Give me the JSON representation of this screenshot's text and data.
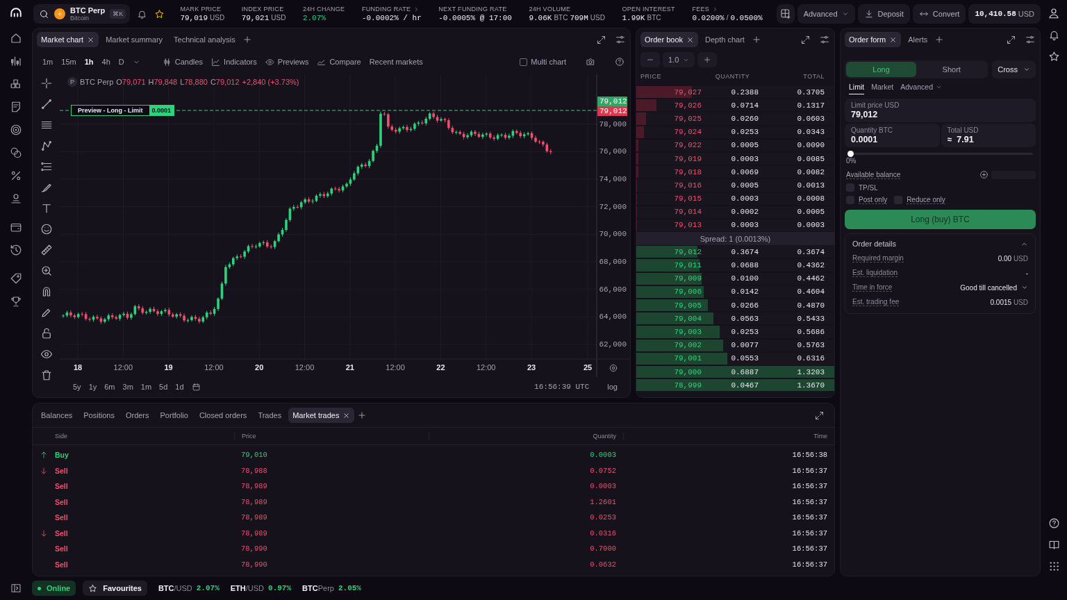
{
  "topbar": {
    "market": {
      "symbol": "BTC Perp",
      "name": "Bitcoin",
      "shortcut": "⌘K"
    },
    "favourite": true,
    "stats": [
      {
        "label": "MARK PRICE",
        "link": false,
        "parts": [
          {
            "text": "79,019",
            "kind": "num"
          },
          {
            "text": "USD",
            "kind": "unit"
          }
        ]
      },
      {
        "label": "INDEX PRICE",
        "link": false,
        "parts": [
          {
            "text": "79,021",
            "kind": "num"
          },
          {
            "text": "USD",
            "kind": "unit"
          }
        ]
      },
      {
        "label": "24H CHANGE",
        "link": false,
        "parts": [
          {
            "text": "2.07%",
            "kind": "up"
          }
        ]
      },
      {
        "label": "FUNDING RATE",
        "link": true,
        "parts": [
          {
            "text": "-0.0002% / hr",
            "kind": "num"
          }
        ]
      },
      {
        "label": "NEXT FUNDING RATE",
        "link": false,
        "parts": [
          {
            "text": "-0.0005% @ 17:00",
            "kind": "num"
          }
        ]
      },
      {
        "label": "24H VOLUME",
        "link": false,
        "parts": [
          {
            "text": "9.06K",
            "kind": "num"
          },
          {
            "text": "BTC",
            "kind": "unit"
          },
          {
            "text": "709M",
            "kind": "num"
          },
          {
            "text": "USD",
            "kind": "unit"
          }
        ]
      },
      {
        "label": "OPEN INTEREST",
        "link": false,
        "parts": [
          {
            "text": "1.99K",
            "kind": "num"
          },
          {
            "text": "BTC",
            "kind": "unit"
          }
        ]
      },
      {
        "label": "FEES",
        "link": true,
        "parts": [
          {
            "text": "0.0200%",
            "kind": "num"
          },
          {
            "text": "/",
            "kind": "unit"
          },
          {
            "text": "0.0500%",
            "kind": "num"
          }
        ]
      }
    ],
    "mode": "Advanced",
    "deposit": "Deposit",
    "convert": "Convert",
    "balance": {
      "value": "10,410.58",
      "unit": "USD"
    }
  },
  "chart_panel": {
    "tabs": [
      {
        "label": "Market chart",
        "selected": true
      },
      {
        "label": "Market summary",
        "selected": false
      },
      {
        "label": "Technical analysis",
        "selected": false
      }
    ],
    "timeframes": [
      {
        "label": "1m",
        "selected": false
      },
      {
        "label": "15m",
        "selected": false
      },
      {
        "label": "1h",
        "selected": true
      },
      {
        "label": "4h",
        "selected": false
      },
      {
        "label": "D",
        "selected": false
      }
    ],
    "tools": [
      {
        "label": "Candles",
        "kind": "candles"
      },
      {
        "label": "Indicators",
        "kind": "indicators"
      },
      {
        "label": "Previews",
        "kind": "previews"
      },
      {
        "label": "Compare",
        "kind": "compare"
      },
      {
        "label": "Recent markets",
        "kind": "plain"
      }
    ],
    "multi_chart": {
      "label": "Multi chart",
      "checked": false
    },
    "legend": {
      "symbol": "BTC Perp",
      "badge": "P",
      "values": [
        {
          "key": "O",
          "value": "79,071"
        },
        {
          "key": "H",
          "value": "79,848"
        },
        {
          "key": "L",
          "value": "78,880"
        },
        {
          "key": "C",
          "value": "79,012"
        }
      ],
      "change": "+2,840 (+3.73%)"
    },
    "preview": {
      "text": "Preview - Long - Limit",
      "quantity": "0.0001"
    },
    "price_axis": [
      "78,000",
      "76,000",
      "74,000",
      "72,000",
      "70,000",
      "68,000",
      "66,000",
      "64,000",
      "62,000"
    ],
    "price_tags": [
      {
        "text": "79,012",
        "kind": "last"
      },
      {
        "text": "79,012",
        "kind": "order"
      }
    ],
    "time_axis": [
      {
        "text": "18",
        "kind": "day"
      },
      {
        "text": "12:00",
        "kind": "time"
      },
      {
        "text": "19",
        "kind": "day"
      },
      {
        "text": "12:00",
        "kind": "time"
      },
      {
        "text": "20",
        "kind": "day"
      },
      {
        "text": "12:00",
        "kind": "time"
      },
      {
        "text": "21",
        "kind": "day"
      },
      {
        "text": "12:00",
        "kind": "time"
      },
      {
        "text": "22",
        "kind": "day"
      },
      {
        "text": "12:00",
        "kind": "time"
      },
      {
        "text": "23",
        "kind": "day"
      },
      {
        "text": "25",
        "kind": "day"
      }
    ],
    "ranges": [
      "5y",
      "1y",
      "6m",
      "3m",
      "1m",
      "5d",
      "1d"
    ],
    "clock": "16:56:39 UTC",
    "scale": "log"
  },
  "order_book": {
    "tabs": [
      {
        "label": "Order book",
        "selected": true
      },
      {
        "label": "Depth chart",
        "selected": false
      }
    ],
    "step": "1.0",
    "columns": [
      "PRICE",
      "QUANTITY",
      "TOTAL"
    ],
    "asks": [
      {
        "price": "79,027",
        "quantity": "0.2388",
        "total": "0.3705",
        "level": 0.28
      },
      {
        "price": "79,026",
        "quantity": "0.0714",
        "total": "0.1317",
        "level": 0.1
      },
      {
        "price": "79,025",
        "quantity": "0.0260",
        "total": "0.0603",
        "level": 0.05
      },
      {
        "price": "79,024",
        "quantity": "0.0253",
        "total": "0.0343",
        "level": 0.04
      },
      {
        "price": "79,022",
        "quantity": "0.0005",
        "total": "0.0090",
        "level": 0.01
      },
      {
        "price": "79,019",
        "quantity": "0.0003",
        "total": "0.0085",
        "level": 0.01
      },
      {
        "price": "79,018",
        "quantity": "0.0069",
        "total": "0.0082",
        "level": 0.01
      },
      {
        "price": "79,016",
        "quantity": "0.0005",
        "total": "0.0013",
        "level": 0.005
      },
      {
        "price": "79,015",
        "quantity": "0.0003",
        "total": "0.0008",
        "level": 0.005
      },
      {
        "price": "79,014",
        "quantity": "0.0002",
        "total": "0.0005",
        "level": 0.005
      },
      {
        "price": "79,013",
        "quantity": "0.0003",
        "total": "0.0003",
        "level": 0.005
      }
    ],
    "spread": "Spread: 1 (0.0013%)",
    "bids": [
      {
        "price": "79,012",
        "quantity": "0.3674",
        "total": "0.3674",
        "level": 0.31
      },
      {
        "price": "79,011",
        "quantity": "0.0688",
        "total": "0.4362",
        "level": 0.32
      },
      {
        "price": "79,009",
        "quantity": "0.0100",
        "total": "0.4462",
        "level": 0.33
      },
      {
        "price": "79,006",
        "quantity": "0.0142",
        "total": "0.4604",
        "level": 0.34
      },
      {
        "price": "79,005",
        "quantity": "0.0266",
        "total": "0.4870",
        "level": 0.36
      },
      {
        "price": "79,004",
        "quantity": "0.0563",
        "total": "0.5433",
        "level": 0.39
      },
      {
        "price": "79,003",
        "quantity": "0.0253",
        "total": "0.5686",
        "level": 0.42
      },
      {
        "price": "79,002",
        "quantity": "0.0077",
        "total": "0.5763",
        "level": 0.44
      },
      {
        "price": "79,001",
        "quantity": "0.0553",
        "total": "0.6316",
        "level": 0.46
      },
      {
        "price": "79,000",
        "quantity": "0.6887",
        "total": "1.3203",
        "level": 1.0
      },
      {
        "price": "78,999",
        "quantity": "0.0467",
        "total": "1.3670",
        "level": 1.0
      }
    ]
  },
  "order_form": {
    "tabs": [
      {
        "label": "Order form",
        "selected": true
      },
      {
        "label": "Alerts",
        "selected": false
      }
    ],
    "sides": [
      {
        "label": "Long",
        "selected": true
      },
      {
        "label": "Short",
        "selected": false
      }
    ],
    "margin_mode": "Cross",
    "order_types": [
      {
        "label": "Limit",
        "selected": true,
        "dropdown": false
      },
      {
        "label": "Market",
        "selected": false,
        "dropdown": false
      },
      {
        "label": "Advanced",
        "selected": false,
        "dropdown": true
      }
    ],
    "limit_price": {
      "label": "Limit price USD",
      "value": "79,012"
    },
    "quantity": {
      "label": "Quantity BTC",
      "value": "0.0001"
    },
    "total": {
      "label": "Total USD",
      "value": "≈  7.91"
    },
    "size_slider": {
      "level": 0,
      "reading": "0%"
    },
    "available_balance": "Available balance",
    "options": [
      {
        "label": "TP/SL",
        "checked": false
      },
      {
        "label": "Post only",
        "checked": false
      },
      {
        "label": "Reduce only",
        "checked": false
      }
    ],
    "submit": "Long (buy) BTC",
    "details": {
      "title": "Order details",
      "expanded": true,
      "rows": [
        {
          "label": "Required margin",
          "kind": "amount",
          "value": "0.00",
          "unit": "USD"
        },
        {
          "label": "Est. liquidation",
          "kind": "amount",
          "value": "-",
          "unit": ""
        },
        {
          "label": "Time in force",
          "kind": "select",
          "value": "Good till cancelled",
          "unit": ""
        },
        {
          "label": "Est. trading fee",
          "kind": "amount",
          "value": "0.0015",
          "unit": "USD"
        }
      ]
    }
  },
  "trades_panel": {
    "tabs": [
      {
        "label": "Balances",
        "selected": false
      },
      {
        "label": "Positions",
        "selected": false
      },
      {
        "label": "Orders",
        "selected": false
      },
      {
        "label": "Portfolio",
        "selected": false
      },
      {
        "label": "Closed orders",
        "selected": false
      },
      {
        "label": "Trades",
        "selected": false
      },
      {
        "label": "Market trades",
        "selected": true
      }
    ],
    "columns": [
      "Side",
      "Price",
      "Quantity",
      "Time"
    ],
    "rows": [
      {
        "side": "Buy",
        "kind": "buy",
        "arrow": true,
        "price": "79,010",
        "quantity": "0.0003",
        "time": "16:56:38"
      },
      {
        "side": "Sell",
        "kind": "sell",
        "arrow": true,
        "price": "78,988",
        "quantity": "0.0752",
        "time": "16:56:37"
      },
      {
        "side": "Sell",
        "kind": "sell",
        "arrow": false,
        "price": "78,989",
        "quantity": "0.0003",
        "time": "16:56:37"
      },
      {
        "side": "Sell",
        "kind": "sell",
        "arrow": false,
        "price": "78,989",
        "quantity": "1.2601",
        "time": "16:56:37"
      },
      {
        "side": "Sell",
        "kind": "sell",
        "arrow": false,
        "price": "78,989",
        "quantity": "0.0253",
        "time": "16:56:37"
      },
      {
        "side": "Sell",
        "kind": "sell",
        "arrow": true,
        "price": "78,989",
        "quantity": "0.0316",
        "time": "16:56:37"
      },
      {
        "side": "Sell",
        "kind": "sell",
        "arrow": false,
        "price": "78,990",
        "quantity": "0.7000",
        "time": "16:56:37"
      },
      {
        "side": "Sell",
        "kind": "sell",
        "arrow": false,
        "price": "78,990",
        "quantity": "0.0632",
        "time": "16:56:37"
      }
    ]
  },
  "status_bar": {
    "connection": {
      "label": "Online",
      "on": true
    },
    "favourites": "Favourites",
    "tickers": [
      {
        "base": "BTC",
        "quote": "/USD",
        "change": "2.07%"
      },
      {
        "base": "ETH",
        "quote": "/USD",
        "change": "0.97%"
      },
      {
        "base": "BTC",
        "quote": "Perp",
        "change": "2.05%"
      }
    ]
  }
}
